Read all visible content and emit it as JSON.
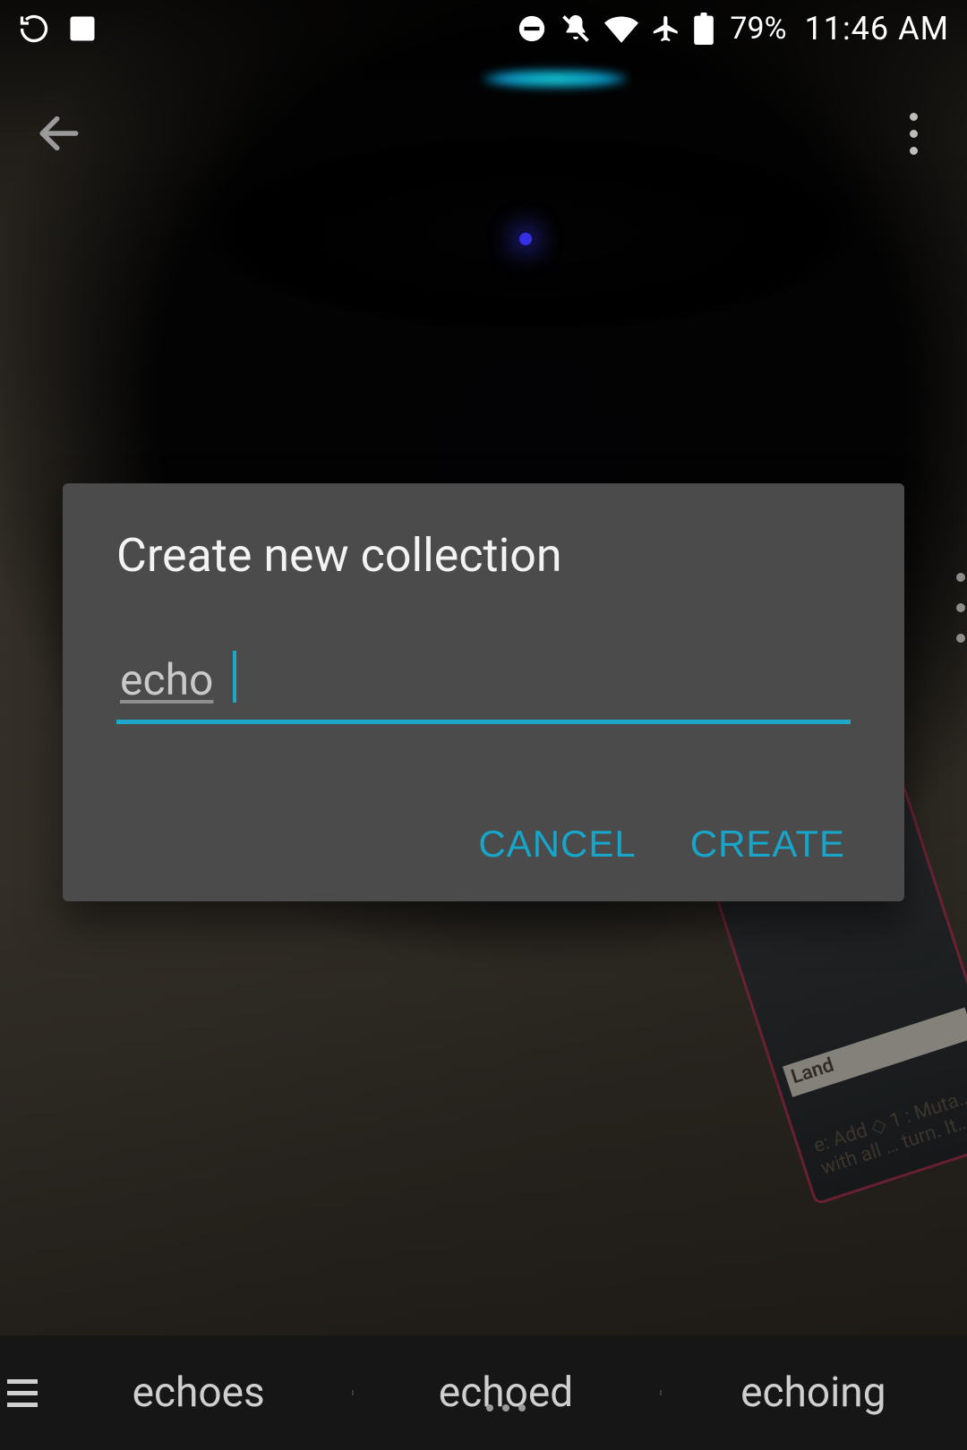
{
  "statusbar": {
    "battery_pct": "79%",
    "time": "11:46 AM"
  },
  "dialog": {
    "title": "Create new collection",
    "input_value": "echo",
    "cancel_label": "CANCEL",
    "create_label": "CREATE"
  },
  "card": {
    "type_label": "Land",
    "rules_text": "e: Add ◇\n1 : Muta…\nwith all …\nturn. It…"
  },
  "keyboard": {
    "suggestions": [
      "echoes",
      "echoed",
      "echoing"
    ]
  },
  "colors": {
    "accent": "#17a6c9",
    "dialog_bg": "#4b4b4b"
  }
}
